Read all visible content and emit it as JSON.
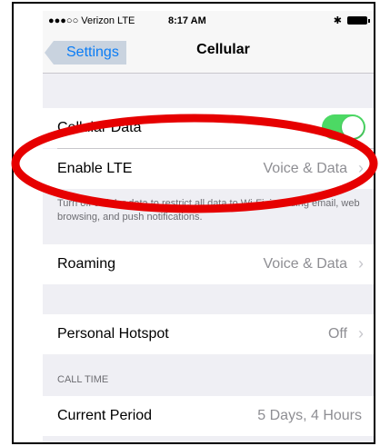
{
  "status_bar": {
    "carrier": "●●●○○ Verizon  LTE",
    "time": "8:17 AM",
    "bluetooth": "✱"
  },
  "nav": {
    "back_label": "Settings",
    "title": "Cellular"
  },
  "rows": {
    "cellular_data": {
      "label": "Cellular Data"
    },
    "enable_lte": {
      "label": "Enable LTE",
      "value": "Voice & Data"
    },
    "roaming": {
      "label": "Roaming",
      "value": "Voice & Data"
    },
    "personal_hotspot": {
      "label": "Personal Hotspot",
      "value": "Off"
    },
    "current_period": {
      "label": "Current Period",
      "value": "5 Days, 4 Hours"
    }
  },
  "footer_note": "Turn off cellular data to restrict all data to Wi-Fi, including email, web browsing, and push notifications.",
  "section_call_time": "CALL TIME",
  "chevron": "›",
  "colors": {
    "toggle_on": "#4cd964",
    "link_blue": "#0a7cf5",
    "annotation_red": "#e60000"
  },
  "icons": [
    "bluetooth-icon",
    "battery-icon",
    "chevron-right-icon",
    "back-chevron-icon"
  ]
}
